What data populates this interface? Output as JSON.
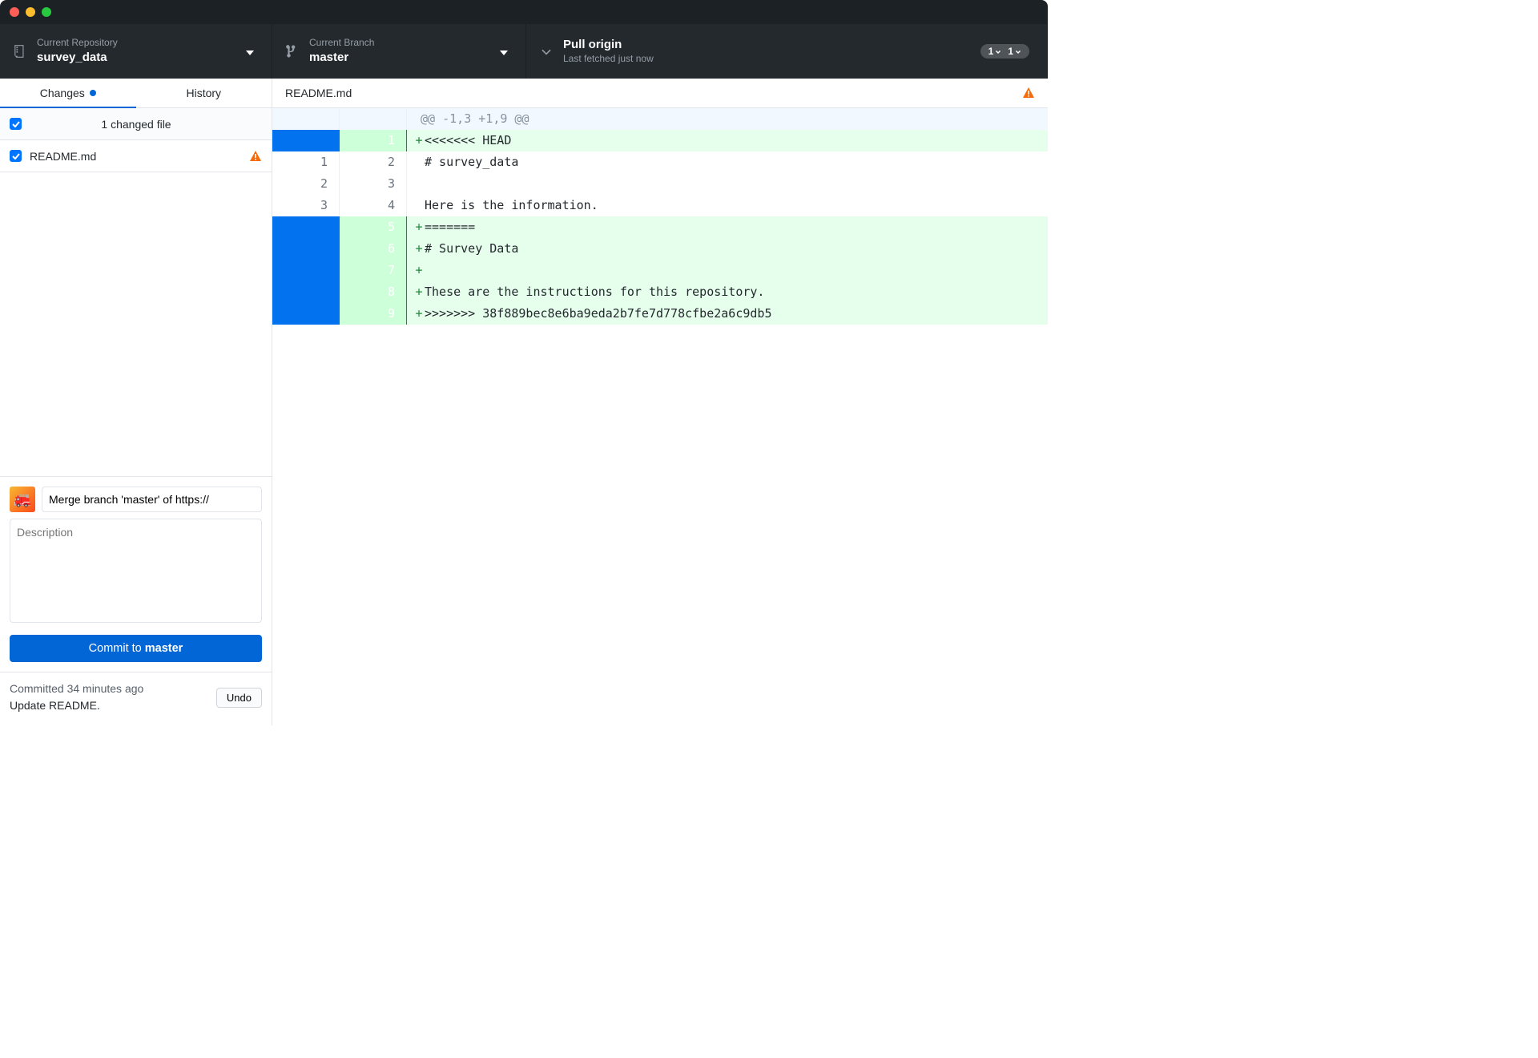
{
  "toolbar": {
    "repo": {
      "label": "Current Repository",
      "value": "survey_data"
    },
    "branch": {
      "label": "Current Branch",
      "value": "master"
    },
    "pull": {
      "label": "Pull origin",
      "sub": "Last fetched just now",
      "behind": "1",
      "ahead": "1"
    }
  },
  "tabs": {
    "changes": "Changes",
    "history": "History"
  },
  "files": {
    "summary": "1 changed file",
    "items": [
      {
        "name": "README.md",
        "conflict": true
      }
    ]
  },
  "commit": {
    "summary_value": "Merge branch 'master' of https://",
    "desc_placeholder": "Description",
    "button_prefix": "Commit to ",
    "button_branch": "master"
  },
  "footer": {
    "line1": "Committed 34 minutes ago",
    "line2": "Update README.",
    "undo": "Undo"
  },
  "diff_header": {
    "filename": "README.md"
  },
  "diff": {
    "hunk": "@@ -1,3 +1,9 @@",
    "lines": [
      {
        "old": "",
        "new": "1",
        "type": "add",
        "sel": true,
        "text": "<<<<<<< HEAD"
      },
      {
        "old": "1",
        "new": "2",
        "type": "ctx",
        "sel": false,
        "text": "# survey_data"
      },
      {
        "old": "2",
        "new": "3",
        "type": "ctx",
        "sel": false,
        "text": ""
      },
      {
        "old": "3",
        "new": "4",
        "type": "ctx",
        "sel": false,
        "text": "Here is the information."
      },
      {
        "old": "",
        "new": "5",
        "type": "add",
        "sel": true,
        "text": "======="
      },
      {
        "old": "",
        "new": "6",
        "type": "add",
        "sel": true,
        "text": "# Survey Data"
      },
      {
        "old": "",
        "new": "7",
        "type": "add",
        "sel": true,
        "text": ""
      },
      {
        "old": "",
        "new": "8",
        "type": "add",
        "sel": true,
        "text": "These are the instructions for this repository."
      },
      {
        "old": "",
        "new": "9",
        "type": "add",
        "sel": true,
        "text": ">>>>>>> 38f889bec8e6ba9eda2b7fe7d778cfbe2a6c9db5"
      }
    ]
  }
}
